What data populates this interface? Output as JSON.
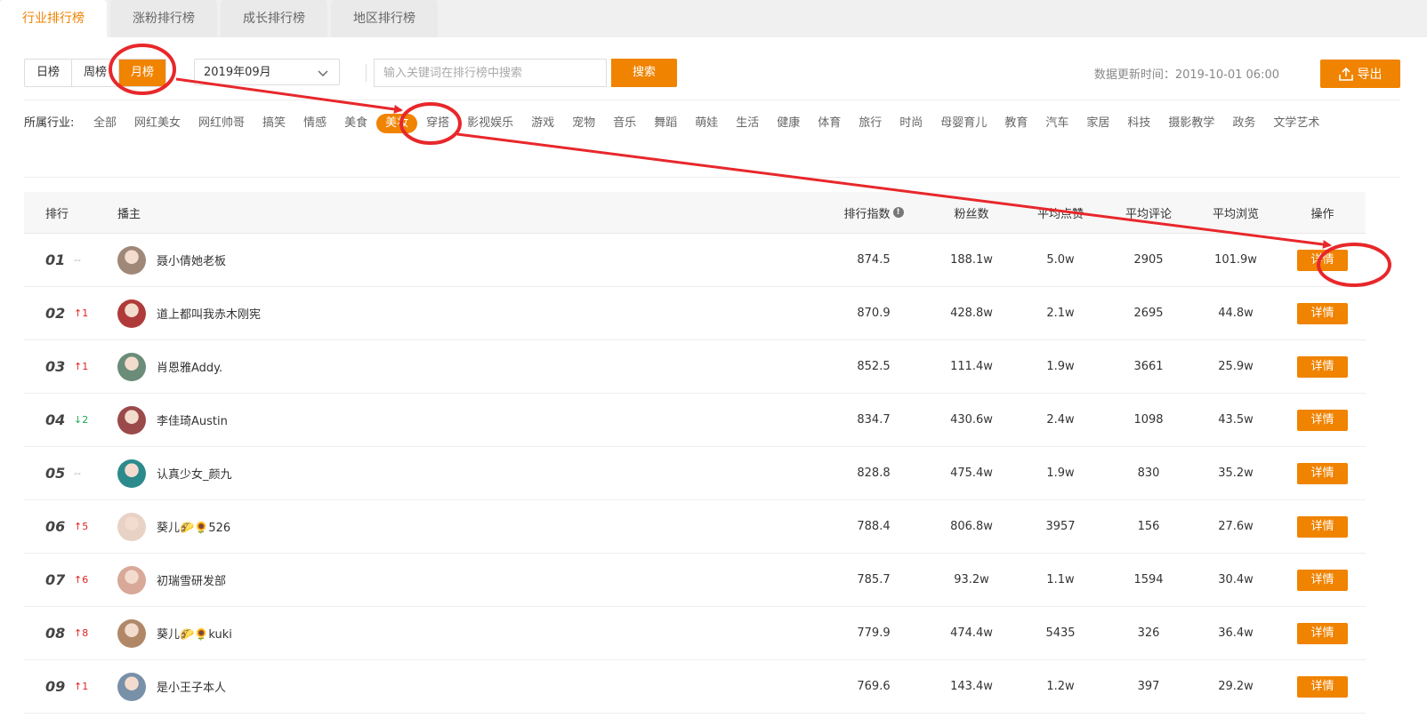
{
  "tabs": [
    {
      "label": "行业排行榜",
      "active": true
    },
    {
      "label": "涨粉排行榜",
      "active": false
    },
    {
      "label": "成长排行榜",
      "active": false
    },
    {
      "label": "地区排行榜",
      "active": false
    }
  ],
  "period": {
    "options": [
      "日榜",
      "周榜",
      "月榜"
    ],
    "selected": "月榜"
  },
  "month_select": {
    "value": "2019年09月"
  },
  "search": {
    "placeholder": "输入关键词在排行榜中搜索",
    "button": "搜索"
  },
  "update_time": "数据更新时间：2019-10-01 06:00",
  "export_label": "导出",
  "industry": {
    "label": "所属行业:",
    "items": [
      "全部",
      "网红美女",
      "网红帅哥",
      "搞笑",
      "情感",
      "美食",
      "美妆",
      "穿搭",
      "影视娱乐",
      "游戏",
      "宠物",
      "音乐",
      "舞蹈",
      "萌娃",
      "生活",
      "健康",
      "体育",
      "旅行",
      "时尚",
      "母婴育儿",
      "教育",
      "汽车",
      "家居",
      "科技",
      "摄影教学",
      "政务",
      "文学艺术"
    ],
    "selected": "美妆"
  },
  "table": {
    "headers": {
      "rank": "排行",
      "host": "播主",
      "index": "排行指数",
      "fans": "粉丝数",
      "likes": "平均点赞",
      "comments": "平均评论",
      "views": "平均浏览",
      "op": "操作"
    },
    "detail_label": "详情",
    "rows": [
      {
        "rank": "01",
        "chg": "--",
        "dir": "same",
        "name": "聂小倩她老板",
        "index": "874.5",
        "fans": "188.1w",
        "likes": "5.0w",
        "comments": "2905",
        "views": "101.9w",
        "avatar": "#a08878"
      },
      {
        "rank": "02",
        "chg": "↑1",
        "dir": "up",
        "name": "道上都叫我赤木刚宪",
        "index": "870.9",
        "fans": "428.8w",
        "likes": "2.1w",
        "comments": "2695",
        "views": "44.8w",
        "avatar": "#b03a3a"
      },
      {
        "rank": "03",
        "chg": "↑1",
        "dir": "up",
        "name": "肖恩雅Addy.",
        "index": "852.5",
        "fans": "111.4w",
        "likes": "1.9w",
        "comments": "3661",
        "views": "25.9w",
        "avatar": "#6a8c78"
      },
      {
        "rank": "04",
        "chg": "↓2",
        "dir": "down",
        "name": "李佳琦Austin",
        "index": "834.7",
        "fans": "430.6w",
        "likes": "2.4w",
        "comments": "1098",
        "views": "43.5w",
        "avatar": "#9a4a4a"
      },
      {
        "rank": "05",
        "chg": "--",
        "dir": "same",
        "name": "认真少女_颜九",
        "index": "828.8",
        "fans": "475.4w",
        "likes": "1.9w",
        "comments": "830",
        "views": "35.2w",
        "avatar": "#2c8a8c"
      },
      {
        "rank": "06",
        "chg": "↑5",
        "dir": "up",
        "name": "葵儿🌮🌻526",
        "index": "788.4",
        "fans": "806.8w",
        "likes": "3957",
        "comments": "156",
        "views": "27.6w",
        "avatar": "#e8d2c6"
      },
      {
        "rank": "07",
        "chg": "↑6",
        "dir": "up",
        "name": "初瑞雪研发部",
        "index": "785.7",
        "fans": "93.2w",
        "likes": "1.1w",
        "comments": "1594",
        "views": "30.4w",
        "avatar": "#d8a898"
      },
      {
        "rank": "08",
        "chg": "↑8",
        "dir": "up",
        "name": "葵儿🌮🌻kuki",
        "index": "779.9",
        "fans": "474.4w",
        "likes": "5435",
        "comments": "326",
        "views": "36.4w",
        "avatar": "#b08868"
      },
      {
        "rank": "09",
        "chg": "↑1",
        "dir": "up",
        "name": "是小王子本人",
        "index": "769.6",
        "fans": "143.4w",
        "likes": "1.2w",
        "comments": "397",
        "views": "29.2w",
        "avatar": "#7890a8"
      }
    ]
  },
  "colors": {
    "accent": "#f08300",
    "annotation": "#e8272b",
    "up": "#e02020",
    "down": "#1aaa55"
  }
}
